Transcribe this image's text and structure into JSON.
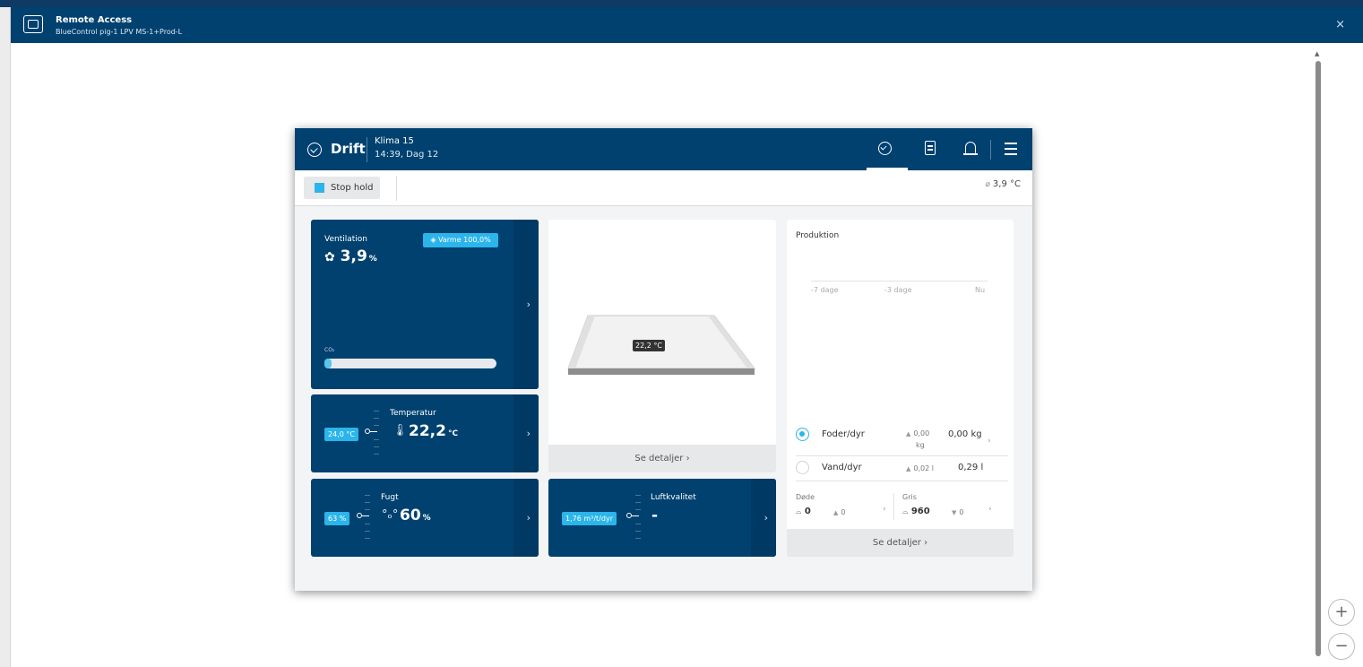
{
  "remote_access": {
    "title": "Remote Access",
    "subtitle": "BlueControl pig-1 LPV MS-1+Prod-L",
    "close_glyph": "×",
    "zoom_in": "+",
    "zoom_out": "−",
    "scroll_up": "▲"
  },
  "header": {
    "section": "Drift",
    "climate": "Klima 15",
    "datetime": "14:39, Dag 12",
    "menu_glyph": "≡"
  },
  "toolbar": {
    "stop_label": "Stop hold",
    "outside_temp": "3,9 °C"
  },
  "tiles": {
    "ventilation": {
      "label": "Ventilation",
      "value": "3,9",
      "unit": "%",
      "heat_badge": "Varme 100,0%",
      "co2_label": "CO₂",
      "co2_level_fraction": 0.04
    },
    "temperature": {
      "label": "Temperatur",
      "setpoint": "24,0 °C",
      "value": "22,2",
      "unit": "°C"
    },
    "humidity": {
      "label": "Fugt",
      "setpoint": "63 %",
      "value": "60",
      "unit": "%"
    },
    "air_quality": {
      "label": "Luftkvalitet",
      "setpoint": "1,76 m³/t/dyr",
      "value": "-"
    },
    "pen": {
      "temp_label": "22,2 °C",
      "details": "Se detaljer"
    }
  },
  "production": {
    "title": "Produktion",
    "axis": [
      "-7 dage",
      "-3 dage",
      "Nu"
    ],
    "feed": {
      "label": "Foder/dyr",
      "change": "0,00",
      "change_unit": "kg",
      "value": "0,00 kg"
    },
    "water": {
      "label": "Vand/dyr",
      "change": "0,02 l",
      "value": "0,29 l"
    },
    "dead": {
      "label": "Døde",
      "value": "0",
      "change": "0"
    },
    "pig": {
      "label": "Gris",
      "value": "960",
      "change": "0"
    },
    "details": "Se detaljer"
  },
  "colors": {
    "brand_dark": "#004170",
    "accent": "#2bb5ea"
  }
}
